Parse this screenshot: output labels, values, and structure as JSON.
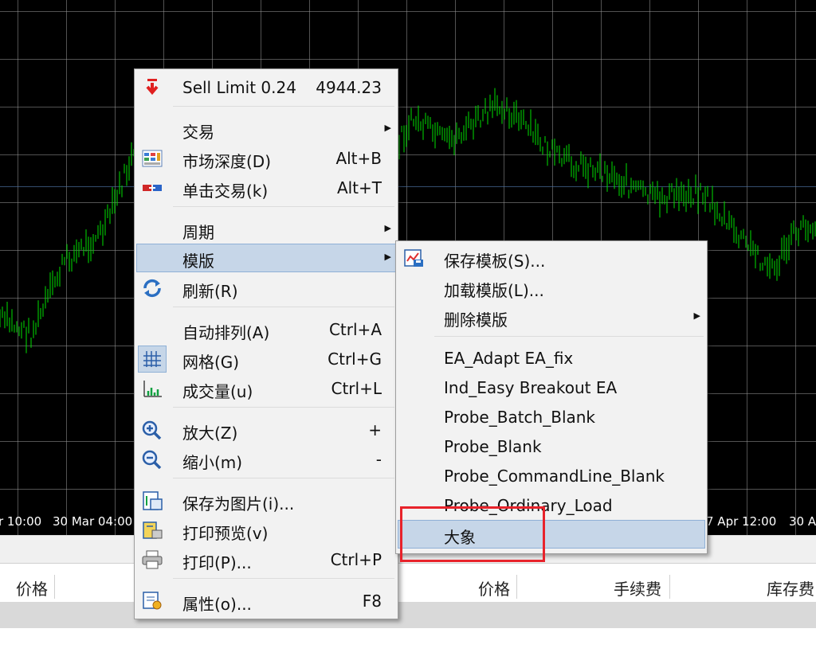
{
  "chart": {
    "time_labels": [
      "r 10:00",
      "30 Mar 04:00",
      "7 Apr 12:00",
      "30 A"
    ]
  },
  "trade_panel": {
    "headers": [
      "价格",
      "价格",
      "手续费",
      "库存费"
    ]
  },
  "context_menu": {
    "items": [
      {
        "label": "Sell Limit 0.24",
        "shortcut": "4944.23",
        "icon": "sell-limit-arrow-icon"
      },
      {
        "label": "交易",
        "submenu": true
      },
      {
        "label": "市场深度(D)",
        "shortcut": "Alt+B",
        "icon": "market-depth-icon"
      },
      {
        "label": "单击交易(k)",
        "shortcut": "Alt+T",
        "icon": "one-click-trading-icon"
      },
      {
        "label": "周期",
        "submenu": true
      },
      {
        "label": "模版",
        "submenu": true,
        "highlighted": true
      },
      {
        "label": "刷新(R)",
        "icon": "refresh-icon"
      },
      {
        "label": "自动排列(A)",
        "shortcut": "Ctrl+A"
      },
      {
        "label": "网格(G)",
        "shortcut": "Ctrl+G",
        "icon": "grid-icon"
      },
      {
        "label": "成交量(u)",
        "shortcut": "Ctrl+L",
        "icon": "volume-icon"
      },
      {
        "label": "放大(Z)",
        "shortcut": "+",
        "icon": "zoom-in-icon"
      },
      {
        "label": "缩小(m)",
        "shortcut": "-",
        "icon": "zoom-out-icon"
      },
      {
        "label": "保存为图片(i)...",
        "icon": "save-image-icon"
      },
      {
        "label": "打印预览(v)",
        "icon": "print-preview-icon"
      },
      {
        "label": "打印(P)...",
        "shortcut": "Ctrl+P",
        "icon": "print-icon"
      },
      {
        "label": "属性(o)...",
        "shortcut": "F8",
        "icon": "properties-icon"
      }
    ]
  },
  "template_submenu": {
    "items": [
      {
        "label": "保存模板(S)...",
        "icon": "save-template-icon"
      },
      {
        "label": "加载模版(L)..."
      },
      {
        "label": "删除模版",
        "submenu": true
      },
      {
        "label": "EA_Adapt EA_fix"
      },
      {
        "label": "Ind_Easy Breakout EA"
      },
      {
        "label": "Probe_Batch_Blank"
      },
      {
        "label": "Probe_Blank"
      },
      {
        "label": "Probe_CommandLine_Blank"
      },
      {
        "label": "Probe_Ordinary_Load"
      },
      {
        "label": "大象",
        "highlighted": true
      }
    ]
  },
  "colors": {
    "chart_bg": "#000000",
    "candles": "#00e000",
    "menu_highlight": "#c6d6e8",
    "annotation_box": "#e8232b"
  }
}
